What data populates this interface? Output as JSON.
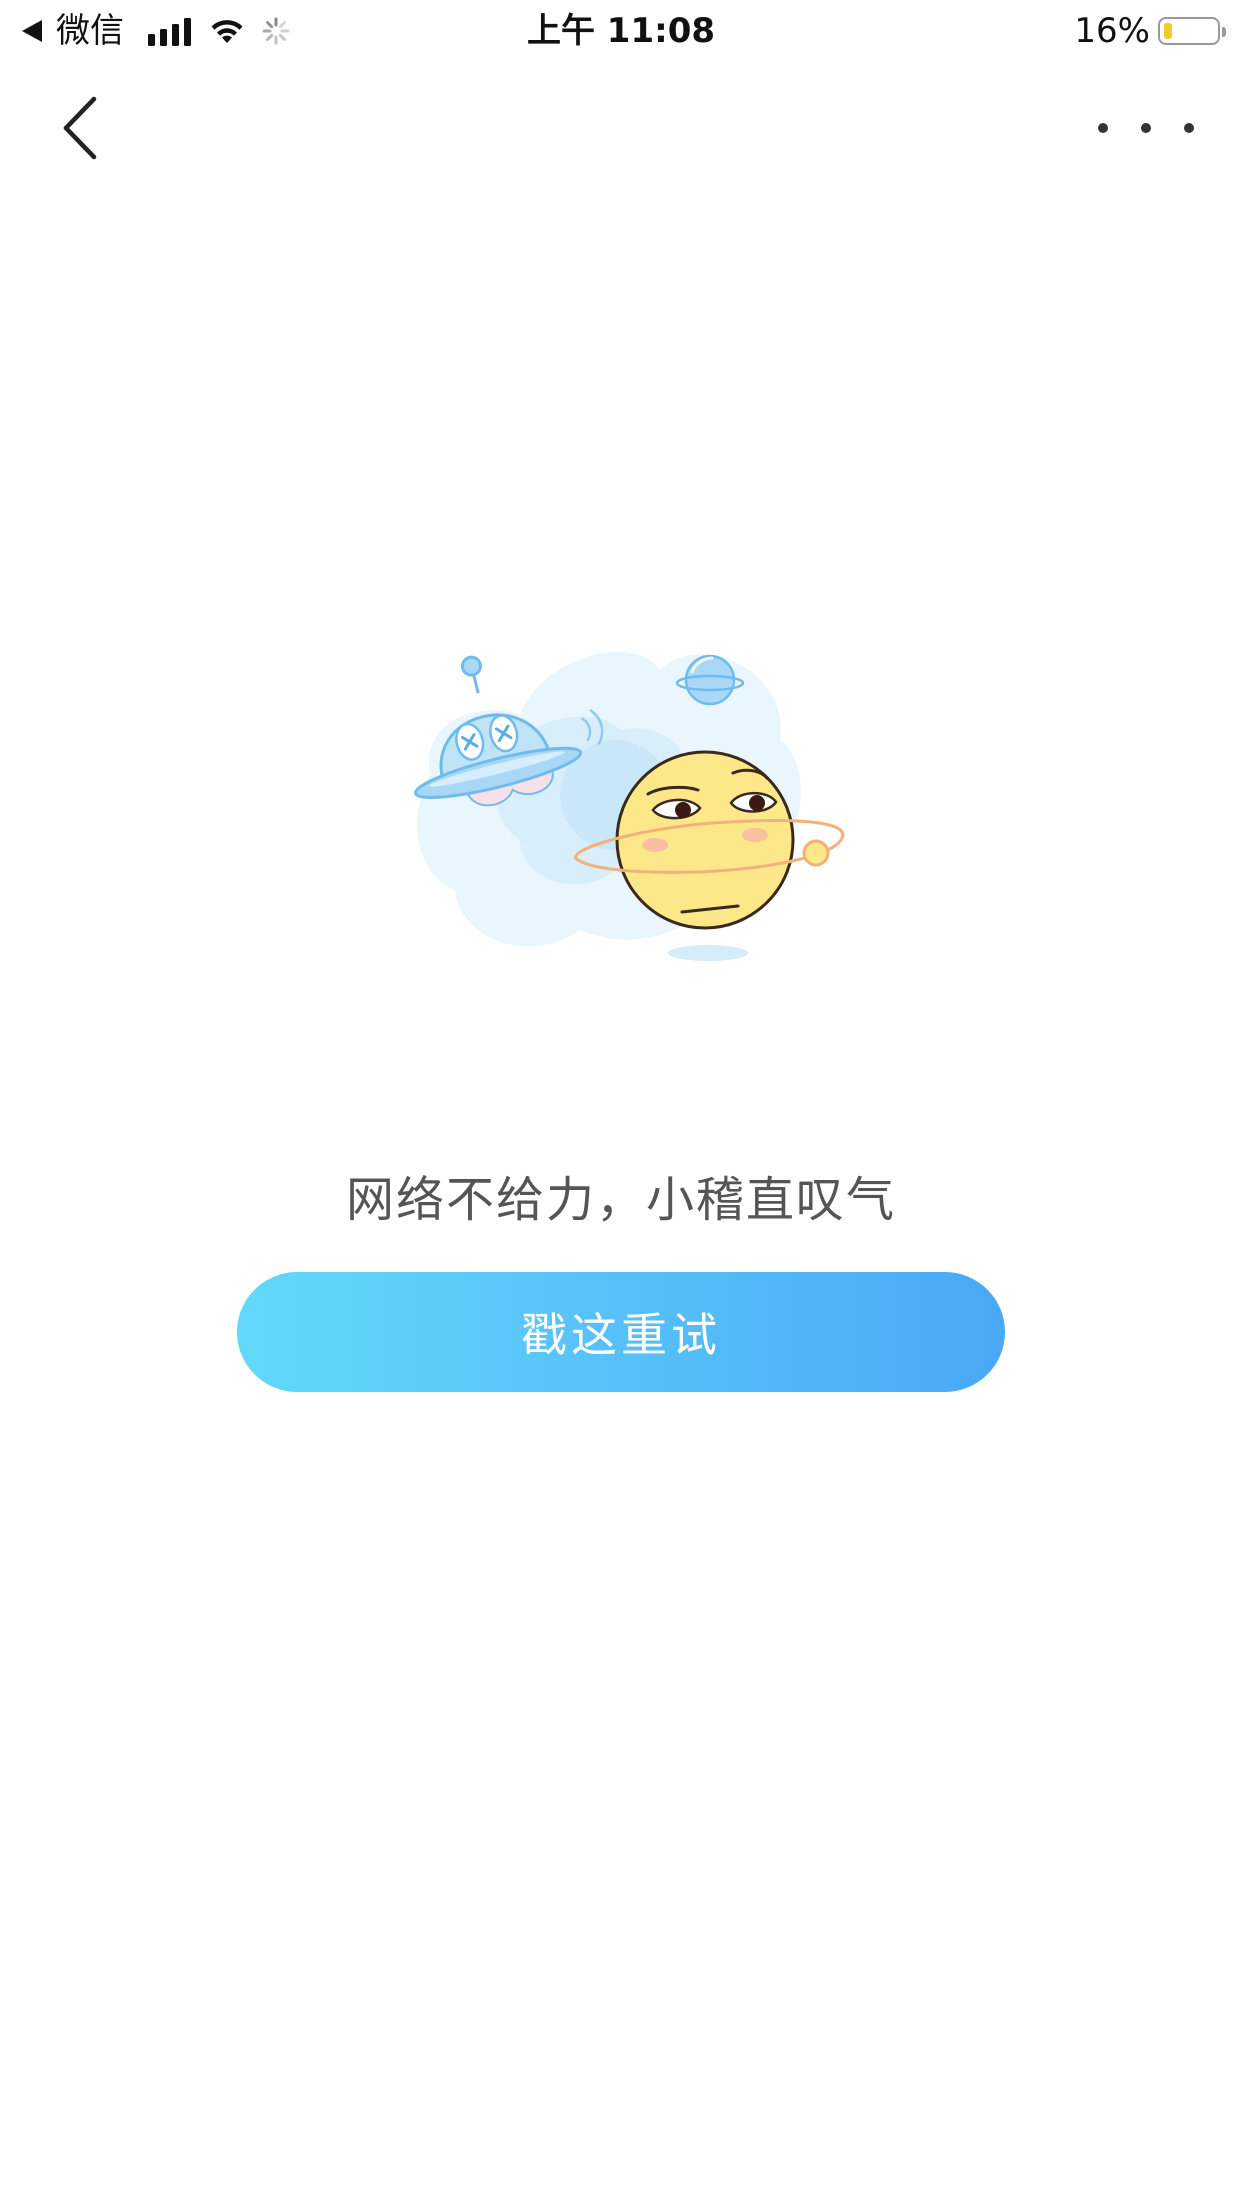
{
  "status_bar": {
    "carrier": "微信",
    "time": "上午 11:08",
    "battery_percent": "16%",
    "battery_level": 0.16,
    "battery_color": "#f4c92a",
    "icons": [
      "back-arrow-icon",
      "signal-icon",
      "wifi-icon",
      "loading-spinner-icon",
      "battery-icon"
    ]
  },
  "nav": {
    "back_icon": "chevron-left-icon",
    "more_icon": "more-dots-icon"
  },
  "error": {
    "message": "网络不给力，小稽直叹气",
    "illustration": "ufo-and-emoji-illustration"
  },
  "retry_button": {
    "label": "戳这重试",
    "gradient_start": "#62d9fa",
    "gradient_end": "#4aa8f5"
  }
}
